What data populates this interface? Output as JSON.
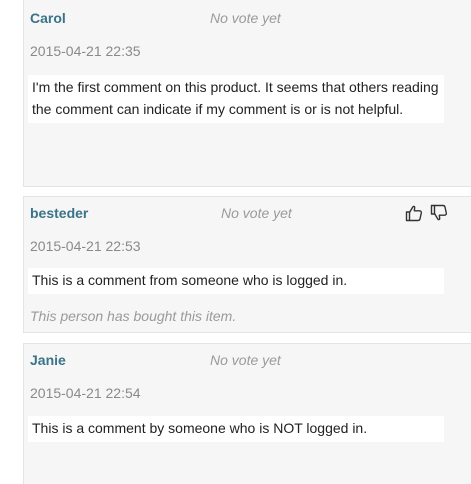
{
  "comments": [
    {
      "author": "Carol",
      "vote_status": "No vote yet",
      "date": "2015-04-21 22:35",
      "text": "I'm the first comment on this product. It seems that others reading the comment can indicate if my comment is or is not helpful."
    },
    {
      "author": "besteder",
      "vote_status": "No vote yet",
      "date": "2015-04-21 22:53",
      "text": "This is a comment from someone who is logged in.",
      "purchase_note": "This person has bought this item.",
      "vote_icons": [
        "thumbs-up-icon",
        "thumbs-down-icon"
      ]
    },
    {
      "author": "Janie",
      "vote_status": "No vote yet",
      "date": "2015-04-21 22:54",
      "text": "This is a comment by someone who is NOT logged in."
    }
  ],
  "colors": {
    "author": "#3a7389",
    "card_background": "#f6f6f6",
    "card_border": "#e4e4e4",
    "muted_text": "#9a9a9a"
  }
}
